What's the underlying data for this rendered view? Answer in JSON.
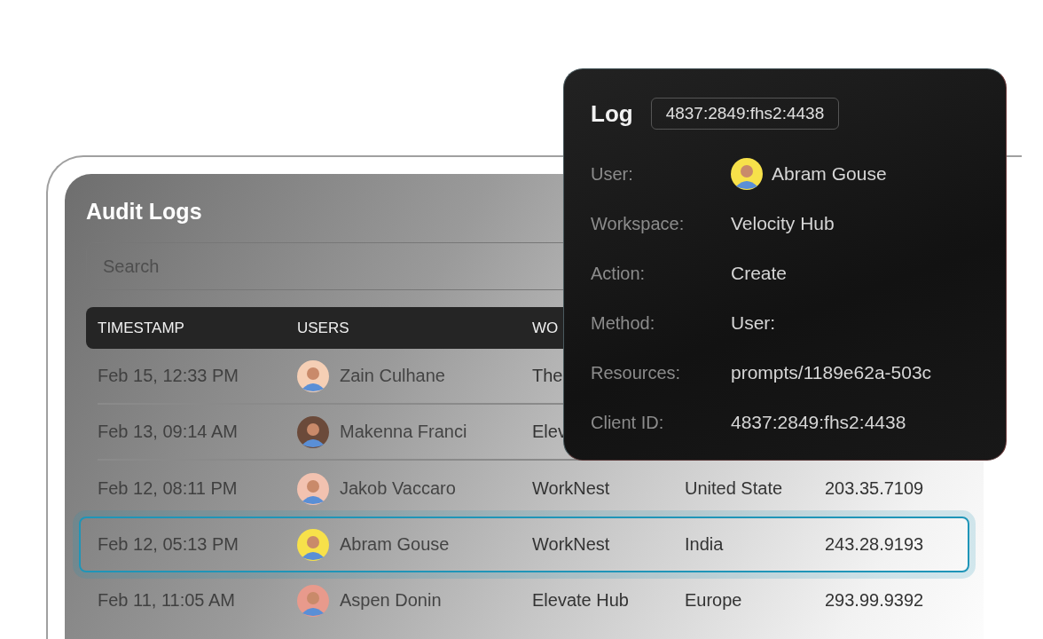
{
  "panel": {
    "title": "Audit Logs",
    "search": {
      "placeholder": "Search"
    }
  },
  "table": {
    "columns": [
      "TIMESTAMP",
      "USERS",
      "WO"
    ],
    "rows": [
      {
        "timestamp": "Feb 15, 12:33 PM",
        "user": "Zain Culhane",
        "color": "#f5cfb5",
        "workspace": "The",
        "selected": false
      },
      {
        "timestamp": "Feb 13, 09:14 AM",
        "user": "Makenna Franci",
        "color": "#6b4a3a",
        "workspace": "Elev",
        "selected": false
      },
      {
        "timestamp": "Feb 12, 08:11 PM",
        "user": "Jakob Vaccaro",
        "color": "#f2c2b0",
        "workspace": "WorkNest",
        "region": "United State",
        "ip": "203.35.7109",
        "selected": false
      },
      {
        "timestamp": "Feb 12, 05:13 PM",
        "user": "Abram Gouse",
        "color": "#f7e14a",
        "workspace": "WorkNest",
        "region": "India",
        "ip": "243.28.9193",
        "selected": true
      },
      {
        "timestamp": "Feb 11, 11:05 AM",
        "user": "Aspen Donin",
        "color": "#e89a8c",
        "workspace": "Elevate Hub",
        "region": "Europe",
        "ip": "293.99.9392",
        "selected": false
      }
    ]
  },
  "log": {
    "title": "Log",
    "id": "4837:2849:fhs2:4438",
    "fields": [
      {
        "kind": "user",
        "label": "User:",
        "value": "Abram Gouse",
        "color": "#f7e14a"
      },
      {
        "kind": "text",
        "label": "Workspace:",
        "value": "Velocity Hub"
      },
      {
        "kind": "text",
        "label": "Action:",
        "value": "Create"
      },
      {
        "kind": "text",
        "label": "Method:",
        "value": "User:"
      },
      {
        "kind": "text",
        "label": "Resources:",
        "value": "prompts/1189e62a-503c"
      },
      {
        "kind": "text",
        "label": "Client ID:",
        "value": "4837:2849:fhs2:4438"
      }
    ]
  }
}
